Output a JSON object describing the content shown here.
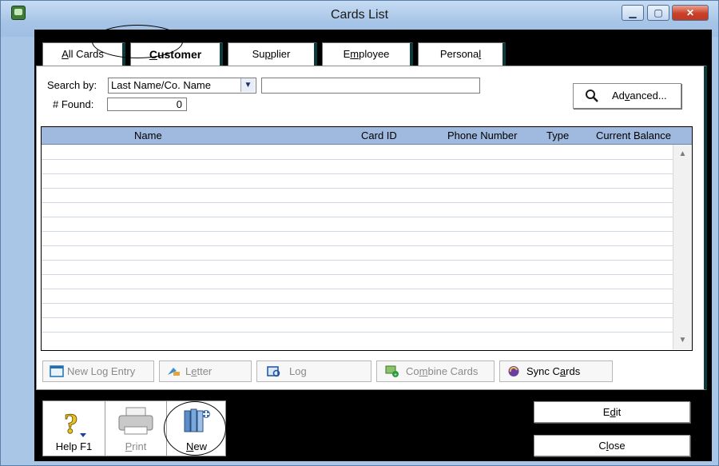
{
  "window": {
    "title": "Cards List",
    "min_label": "▁",
    "max_label": "▢",
    "close_label": "✕"
  },
  "tabs": [
    {
      "label_pre": "",
      "label_u": "A",
      "label_post": "ll Cards"
    },
    {
      "label_pre": "",
      "label_u": "C",
      "label_post": "ustomer"
    },
    {
      "label_pre": "Su",
      "label_u": "p",
      "label_post": "plier"
    },
    {
      "label_pre": "E",
      "label_u": "m",
      "label_post": "ployee"
    },
    {
      "label_pre": "Persona",
      "label_u": "l",
      "label_post": ""
    }
  ],
  "search": {
    "by_label": "Search by:",
    "by_value": "Last Name/Co. Name",
    "text_value": "",
    "found_label": "# Found:",
    "found_value": "0",
    "advanced_pre": "Ad",
    "advanced_u": "v",
    "advanced_post": "anced..."
  },
  "grid": {
    "columns": [
      "Name",
      "Card ID",
      "Phone Number",
      "Type",
      "Current Balance"
    ],
    "rows": []
  },
  "toolbar": {
    "new_log_entry": "New Log Entry",
    "letter_pre": "L",
    "letter_u": "e",
    "letter_post": "tter",
    "log": "Log",
    "combine_pre": "Co",
    "combine_u": "m",
    "combine_post": "bine Cards",
    "sync_pre": "Sync C",
    "sync_u": "a",
    "sync_post": "rds"
  },
  "bottom": {
    "help_label": "Help F1",
    "print_pre": "",
    "print_u": "P",
    "print_post": "rint",
    "new_pre": "",
    "new_u": "N",
    "new_post": "ew",
    "edit_pre": "E",
    "edit_u": "d",
    "edit_post": "it",
    "close_pre": "C",
    "close_u": "l",
    "close_post": "ose"
  },
  "colors": {
    "accent": "#9fb9df",
    "frame": "#a9c6e6",
    "close": "#c8402a"
  }
}
